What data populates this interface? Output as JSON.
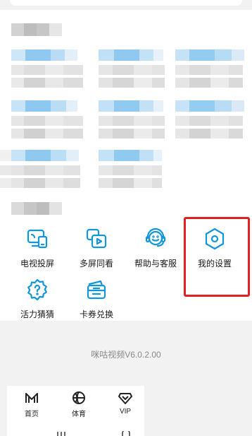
{
  "services": [
    {
      "label": "电视投屏",
      "icon": "tv-cast-icon"
    },
    {
      "label": "多屏同看",
      "icon": "multi-screen-icon"
    },
    {
      "label": "帮助与客服",
      "icon": "customer-service-icon"
    },
    {
      "label": "我的设置",
      "icon": "settings-hexagon-icon"
    },
    {
      "label": "活力猜猜",
      "icon": "quiz-badge-icon"
    },
    {
      "label": "卡券兑换",
      "icon": "coupon-gift-icon"
    }
  ],
  "version_text": "咪咕视频V6.0.2.00",
  "tabbar": {
    "items": [
      {
        "label": "首页",
        "icon": "home-m-icon"
      },
      {
        "label": "体育",
        "icon": "basketball-icon"
      },
      {
        "label": "VIP",
        "icon": "vip-heart-icon"
      }
    ]
  },
  "colors": {
    "accent": "#1296db",
    "highlight": "#e0211f",
    "blur_blue": "#a8d4f3",
    "blur_gray": "#d8d8d8"
  }
}
